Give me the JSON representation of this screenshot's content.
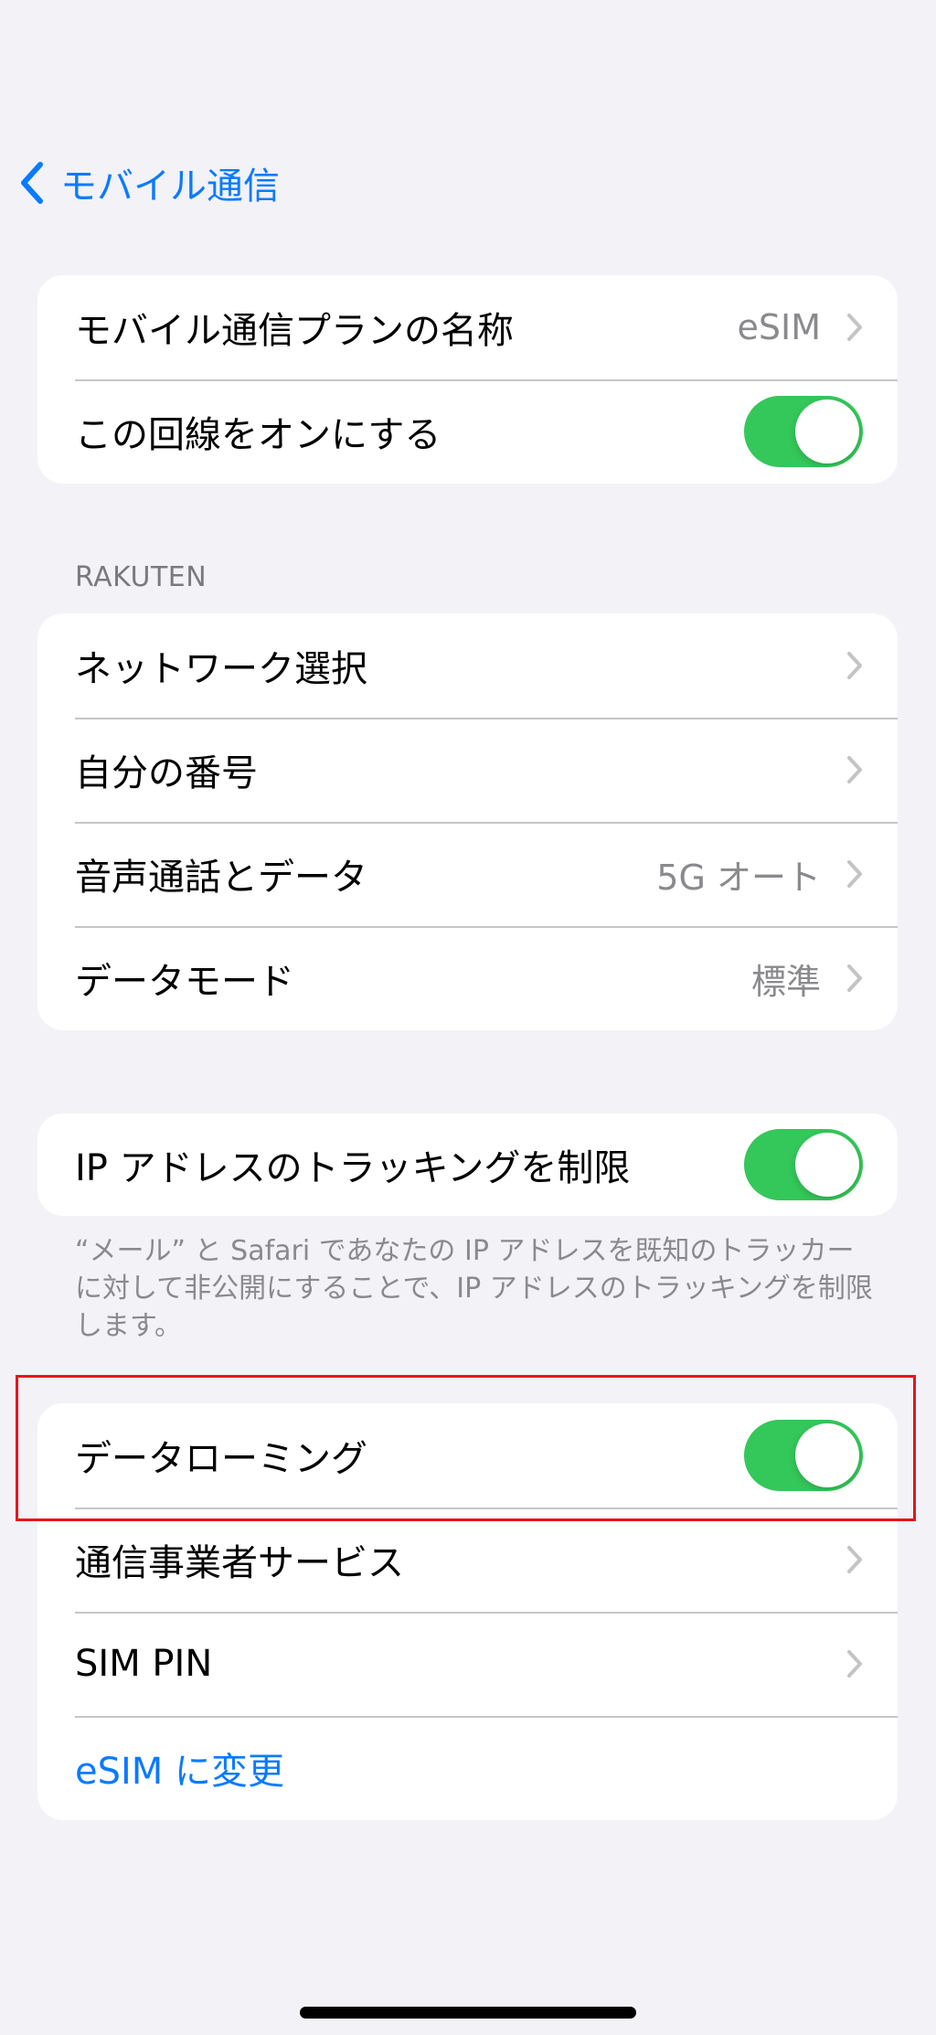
{
  "nav": {
    "back_label": "モバイル通信"
  },
  "group1": {
    "plan_name": {
      "label": "モバイル通信プランの名称",
      "value": "eSIM"
    },
    "line_on": {
      "label": "この回線をオンにする",
      "toggle_state": "on"
    }
  },
  "rakuten": {
    "header": "RAKUTEN",
    "network_select": {
      "label": "ネットワーク選択"
    },
    "my_number": {
      "label": "自分の番号"
    },
    "voice_data": {
      "label": "音声通話とデータ",
      "value": "5G オート"
    },
    "data_mode": {
      "label": "データモード",
      "value": "標準"
    }
  },
  "ip_tracking": {
    "label": "IP アドレスのトラッキングを制限",
    "toggle_state": "on",
    "footnote": "“メール” と Safari であなたの IP アドレスを既知のトラッカーに対して非公開にすることで、IP アドレスのトラッキングを制限します。"
  },
  "group4": {
    "data_roaming": {
      "label": "データローミング",
      "toggle_state": "on"
    },
    "carrier_services": {
      "label": "通信事業者サービス"
    },
    "sim_pin": {
      "label": "SIM PIN"
    },
    "convert_esim": {
      "label": "eSIM に変更"
    }
  },
  "colors": {
    "accent": "#0a7aff",
    "toggle_on": "#34c759",
    "highlight_box": "#e8141c",
    "background": "#f2f2f7"
  }
}
